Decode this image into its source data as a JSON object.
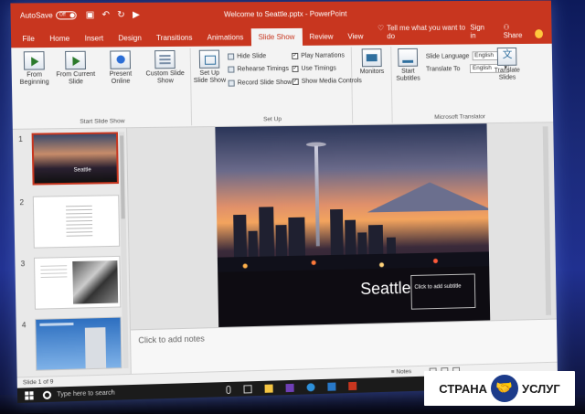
{
  "app": {
    "autosave_label": "AutoSave",
    "autosave_state": "Off",
    "document_title": "Welcome to Seattle.pptx - PowerPoint"
  },
  "tabs": [
    "File",
    "Home",
    "Insert",
    "Design",
    "Transitions",
    "Animations",
    "Slide Show",
    "Review",
    "View"
  ],
  "active_tab": "Slide Show",
  "tell_me": "Tell me what you want to do",
  "signin": "Sign in",
  "share": "Share",
  "ribbon": {
    "start_group": {
      "label": "Start Slide Show",
      "from_beginning": "From Beginning",
      "from_current": "From Current Slide",
      "present_online": "Present Online",
      "custom_show": "Custom Slide Show"
    },
    "setup_group": {
      "label": "Set Up",
      "setup_show": "Set Up Slide Show",
      "hide_slide": "Hide Slide",
      "rehearse": "Rehearse Timings",
      "record": "Record Slide Show",
      "play_narrations": "Play Narrations",
      "use_timings": "Use Timings",
      "show_media": "Show Media Controls"
    },
    "monitors_group": {
      "monitors": "Monitors"
    },
    "translator_group": {
      "label": "Microsoft Translator",
      "start_subtitles": "Start Subtitles",
      "slide_language": "Slide Language",
      "slide_language_value": "English",
      "translate_to": "Translate To",
      "translate_to_value": "English",
      "translate_slides": "Translate Slides"
    }
  },
  "thumbnails": [
    {
      "num": "1",
      "label": "Seattle"
    },
    {
      "num": "2"
    },
    {
      "num": "3"
    },
    {
      "num": "4"
    }
  ],
  "slide": {
    "title": "Seattle",
    "subtitle_placeholder": "Click to add subtitle"
  },
  "notes_placeholder": "Click to add notes",
  "status": {
    "slide_counter": "Slide 1 of 9",
    "notes": "Notes"
  },
  "taskbar": {
    "search_placeholder": "Type here to search"
  },
  "badge": {
    "left": "СТРАНА",
    "right": "УСЛУГ"
  },
  "colors": {
    "accent": "#c8361f",
    "badge_icon": "#1c3b8a"
  }
}
